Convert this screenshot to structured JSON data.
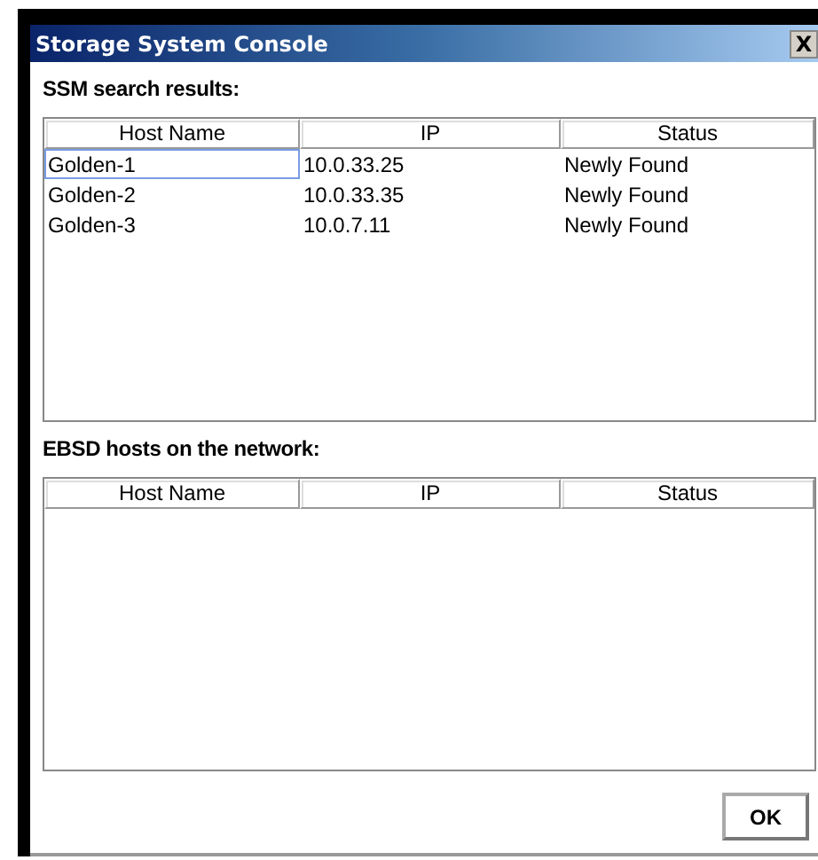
{
  "window": {
    "title": "Storage System Console",
    "close": "X"
  },
  "sections": [
    {
      "label": "SSM search results:",
      "columns": [
        "Host Name",
        "IP",
        "Status"
      ],
      "rows": [
        {
          "cells": [
            "Golden-1",
            "10.0.33.25",
            "Newly Found"
          ],
          "focused": true
        },
        {
          "cells": [
            "Golden-2",
            "10.0.33.35",
            "Newly Found"
          ],
          "focused": false
        },
        {
          "cells": [
            "Golden-3",
            "10.0.7.11",
            "Newly Found"
          ],
          "focused": false
        }
      ]
    },
    {
      "label": "EBSD hosts on the network:",
      "columns": [
        "Host Name",
        "IP",
        "Status"
      ]
    }
  ],
  "buttons": [
    "OK"
  ]
}
